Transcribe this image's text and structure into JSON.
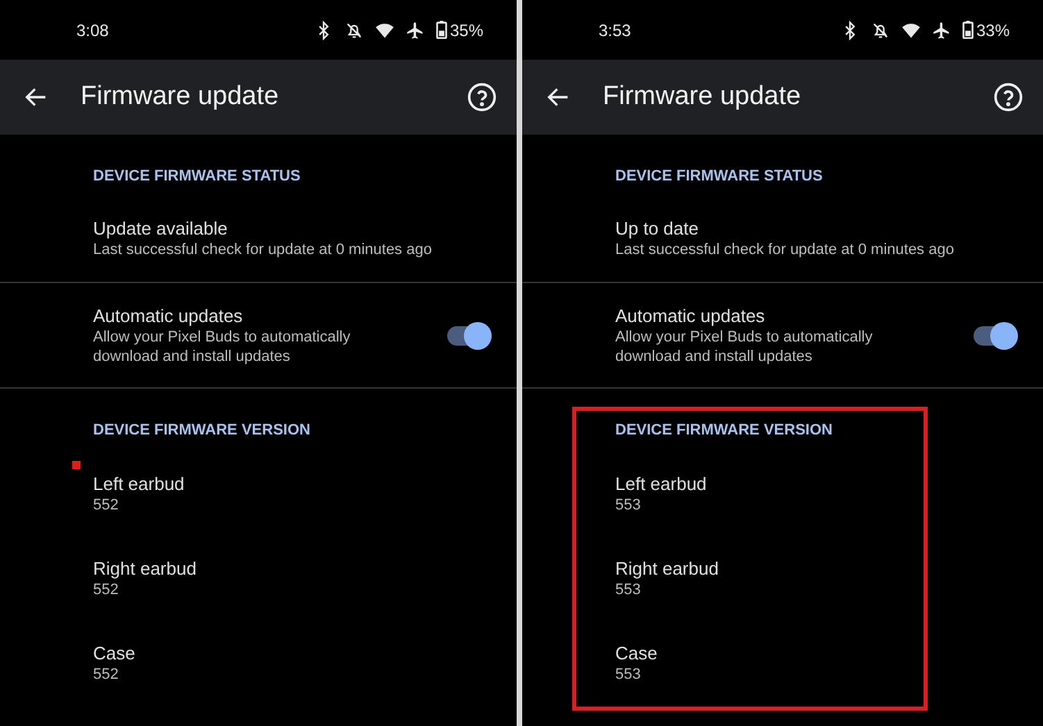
{
  "panels": [
    {
      "status_bar": {
        "time": "3:08",
        "battery": "35%"
      },
      "title": "Firmware update",
      "status_section": {
        "header": "DEVICE FIRMWARE STATUS",
        "status": "Update available",
        "detail": "Last successful check for update at 0 minutes ago"
      },
      "auto_updates": {
        "title": "Automatic updates",
        "description": "Allow your Pixel Buds to automatically download and install updates",
        "on": true
      },
      "version_section": {
        "header": "DEVICE FIRMWARE VERSION",
        "items": [
          {
            "name": "Left earbud",
            "version": "552"
          },
          {
            "name": "Right earbud",
            "version": "552"
          },
          {
            "name": "Case",
            "version": "552"
          }
        ]
      },
      "annotation": {
        "kind": "dot"
      }
    },
    {
      "status_bar": {
        "time": "3:53",
        "battery": "33%"
      },
      "title": "Firmware update",
      "status_section": {
        "header": "DEVICE FIRMWARE STATUS",
        "status": "Up to date",
        "detail": "Last successful check for update at 0 minutes ago"
      },
      "auto_updates": {
        "title": "Automatic updates",
        "description": "Allow your Pixel Buds to automatically download and install updates",
        "on": true
      },
      "version_section": {
        "header": "DEVICE FIRMWARE VERSION",
        "items": [
          {
            "name": "Left earbud",
            "version": "553"
          },
          {
            "name": "Right earbud",
            "version": "553"
          },
          {
            "name": "Case",
            "version": "553"
          }
        ]
      },
      "annotation": {
        "kind": "box"
      }
    }
  ]
}
